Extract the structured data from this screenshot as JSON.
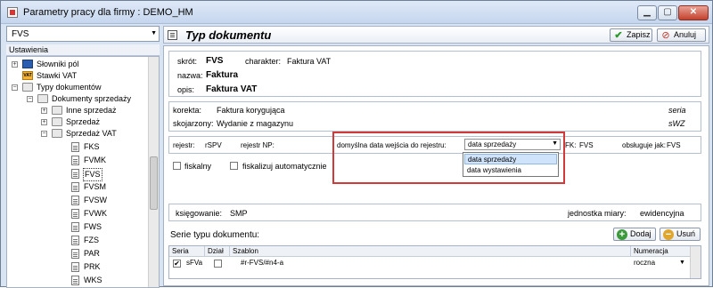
{
  "window": {
    "title": "Parametry pracy dla firmy : DEMO_HM"
  },
  "left": {
    "combo_value": "FVS",
    "tree_header": "Ustawienia",
    "tree": [
      {
        "label": "Słowniki pól"
      },
      {
        "label": "Stawki VAT"
      },
      {
        "label": "Typy dokumentów"
      },
      {
        "label": "Dokumenty sprzedaży"
      },
      {
        "label": "Inne sprzedaż"
      },
      {
        "label": "Sprzedaż"
      },
      {
        "label": "Sprzedaż VAT"
      },
      {
        "label": "FKS"
      },
      {
        "label": "FVMK"
      },
      {
        "label": "FVS"
      },
      {
        "label": "FVSM"
      },
      {
        "label": "FVSW"
      },
      {
        "label": "FVWK"
      },
      {
        "label": "FWS"
      },
      {
        "label": "FZS"
      },
      {
        "label": "PAR"
      },
      {
        "label": "PRK"
      },
      {
        "label": "WKS"
      }
    ]
  },
  "header": {
    "title": "Typ dokumentu",
    "save_label": "Zapisz",
    "cancel_label": "Anuluj"
  },
  "doc": {
    "skrot_label": "skrót:",
    "skrot_value": "FVS",
    "charakter_label": "charakter:",
    "charakter_value": "Faktura VAT",
    "nazwa_label": "nazwa:",
    "nazwa_value": "Faktura",
    "opis_label": "opis:",
    "opis_value": "Faktura VAT",
    "korekta_label": "korekta:",
    "korekta_value": "Faktura korygująca",
    "korekta_seria": "seria",
    "skojarzony_label": "skojarzony:",
    "skojarzony_value": "Wydanie z magazynu",
    "skojarzony_seria": "sWZ",
    "rejestr_label": "rejestr:",
    "rejestr_value": "rSPV",
    "rejestr_np_label": "rejestr NP:",
    "data_label": "domyślna data wejścia do rejestru:",
    "data_value": "data sprzedaży",
    "data_options": [
      "data sprzedaży",
      "data wystawienia"
    ],
    "fk_label": "FK:",
    "fk_value": "FVS",
    "obsluguje_label": "obsługuje jak:",
    "obsluguje_value": "FVS",
    "fiskalny_label": "fiskalny",
    "fiskalizuj_label": "fiskalizuj automatycznie",
    "ksiegowanie_label": "księgowanie:",
    "ksiegowanie_value": "SMP",
    "jm_label": "jednostka miary:",
    "jm_value": "ewidencyjna"
  },
  "series": {
    "title": "Serie typu dokumentu:",
    "add_label": "Dodaj",
    "remove_label": "Usuń",
    "columns": [
      "Seria",
      "Dział",
      "Szablon",
      "Numeracja"
    ],
    "rows": [
      {
        "seria": "sFVa",
        "szablon": "#r-FVS/#n4-a",
        "numeracja": "roczna"
      }
    ]
  },
  "colors": {
    "accent_red": "#d23a3a",
    "highlight": "#cfe3fb"
  }
}
